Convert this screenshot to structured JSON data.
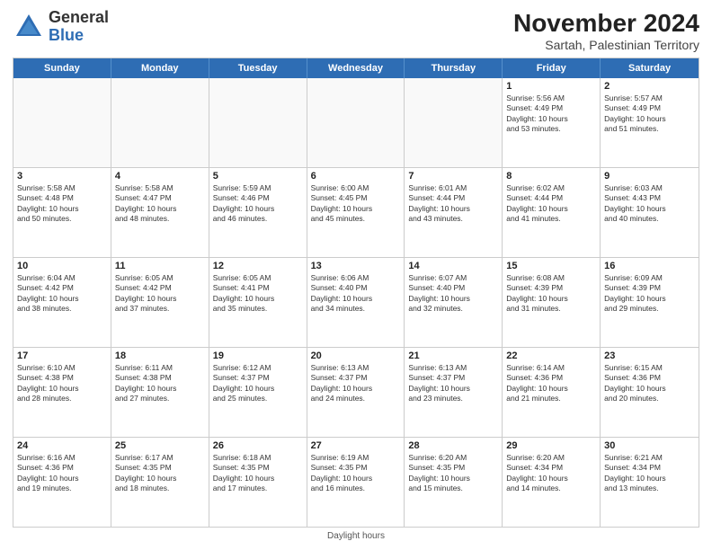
{
  "header": {
    "logo_general": "General",
    "logo_blue": "Blue",
    "month_title": "November 2024",
    "subtitle": "Sartah, Palestinian Territory"
  },
  "days_of_week": [
    "Sunday",
    "Monday",
    "Tuesday",
    "Wednesday",
    "Thursday",
    "Friday",
    "Saturday"
  ],
  "footer": {
    "daylight_hours": "Daylight hours"
  },
  "weeks": [
    [
      {
        "day": "",
        "info": ""
      },
      {
        "day": "",
        "info": ""
      },
      {
        "day": "",
        "info": ""
      },
      {
        "day": "",
        "info": ""
      },
      {
        "day": "",
        "info": ""
      },
      {
        "day": "1",
        "info": "Sunrise: 5:56 AM\nSunset: 4:49 PM\nDaylight: 10 hours\nand 53 minutes."
      },
      {
        "day": "2",
        "info": "Sunrise: 5:57 AM\nSunset: 4:49 PM\nDaylight: 10 hours\nand 51 minutes."
      }
    ],
    [
      {
        "day": "3",
        "info": "Sunrise: 5:58 AM\nSunset: 4:48 PM\nDaylight: 10 hours\nand 50 minutes."
      },
      {
        "day": "4",
        "info": "Sunrise: 5:58 AM\nSunset: 4:47 PM\nDaylight: 10 hours\nand 48 minutes."
      },
      {
        "day": "5",
        "info": "Sunrise: 5:59 AM\nSunset: 4:46 PM\nDaylight: 10 hours\nand 46 minutes."
      },
      {
        "day": "6",
        "info": "Sunrise: 6:00 AM\nSunset: 4:45 PM\nDaylight: 10 hours\nand 45 minutes."
      },
      {
        "day": "7",
        "info": "Sunrise: 6:01 AM\nSunset: 4:44 PM\nDaylight: 10 hours\nand 43 minutes."
      },
      {
        "day": "8",
        "info": "Sunrise: 6:02 AM\nSunset: 4:44 PM\nDaylight: 10 hours\nand 41 minutes."
      },
      {
        "day": "9",
        "info": "Sunrise: 6:03 AM\nSunset: 4:43 PM\nDaylight: 10 hours\nand 40 minutes."
      }
    ],
    [
      {
        "day": "10",
        "info": "Sunrise: 6:04 AM\nSunset: 4:42 PM\nDaylight: 10 hours\nand 38 minutes."
      },
      {
        "day": "11",
        "info": "Sunrise: 6:05 AM\nSunset: 4:42 PM\nDaylight: 10 hours\nand 37 minutes."
      },
      {
        "day": "12",
        "info": "Sunrise: 6:05 AM\nSunset: 4:41 PM\nDaylight: 10 hours\nand 35 minutes."
      },
      {
        "day": "13",
        "info": "Sunrise: 6:06 AM\nSunset: 4:40 PM\nDaylight: 10 hours\nand 34 minutes."
      },
      {
        "day": "14",
        "info": "Sunrise: 6:07 AM\nSunset: 4:40 PM\nDaylight: 10 hours\nand 32 minutes."
      },
      {
        "day": "15",
        "info": "Sunrise: 6:08 AM\nSunset: 4:39 PM\nDaylight: 10 hours\nand 31 minutes."
      },
      {
        "day": "16",
        "info": "Sunrise: 6:09 AM\nSunset: 4:39 PM\nDaylight: 10 hours\nand 29 minutes."
      }
    ],
    [
      {
        "day": "17",
        "info": "Sunrise: 6:10 AM\nSunset: 4:38 PM\nDaylight: 10 hours\nand 28 minutes."
      },
      {
        "day": "18",
        "info": "Sunrise: 6:11 AM\nSunset: 4:38 PM\nDaylight: 10 hours\nand 27 minutes."
      },
      {
        "day": "19",
        "info": "Sunrise: 6:12 AM\nSunset: 4:37 PM\nDaylight: 10 hours\nand 25 minutes."
      },
      {
        "day": "20",
        "info": "Sunrise: 6:13 AM\nSunset: 4:37 PM\nDaylight: 10 hours\nand 24 minutes."
      },
      {
        "day": "21",
        "info": "Sunrise: 6:13 AM\nSunset: 4:37 PM\nDaylight: 10 hours\nand 23 minutes."
      },
      {
        "day": "22",
        "info": "Sunrise: 6:14 AM\nSunset: 4:36 PM\nDaylight: 10 hours\nand 21 minutes."
      },
      {
        "day": "23",
        "info": "Sunrise: 6:15 AM\nSunset: 4:36 PM\nDaylight: 10 hours\nand 20 minutes."
      }
    ],
    [
      {
        "day": "24",
        "info": "Sunrise: 6:16 AM\nSunset: 4:36 PM\nDaylight: 10 hours\nand 19 minutes."
      },
      {
        "day": "25",
        "info": "Sunrise: 6:17 AM\nSunset: 4:35 PM\nDaylight: 10 hours\nand 18 minutes."
      },
      {
        "day": "26",
        "info": "Sunrise: 6:18 AM\nSunset: 4:35 PM\nDaylight: 10 hours\nand 17 minutes."
      },
      {
        "day": "27",
        "info": "Sunrise: 6:19 AM\nSunset: 4:35 PM\nDaylight: 10 hours\nand 16 minutes."
      },
      {
        "day": "28",
        "info": "Sunrise: 6:20 AM\nSunset: 4:35 PM\nDaylight: 10 hours\nand 15 minutes."
      },
      {
        "day": "29",
        "info": "Sunrise: 6:20 AM\nSunset: 4:34 PM\nDaylight: 10 hours\nand 14 minutes."
      },
      {
        "day": "30",
        "info": "Sunrise: 6:21 AM\nSunset: 4:34 PM\nDaylight: 10 hours\nand 13 minutes."
      }
    ]
  ]
}
